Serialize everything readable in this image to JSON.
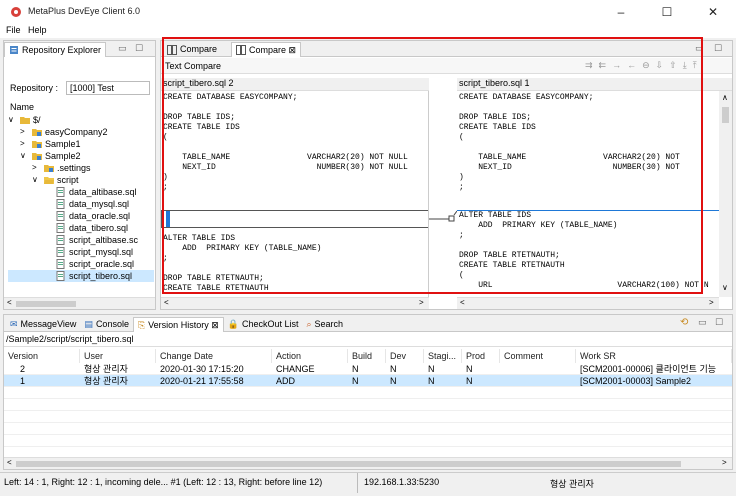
{
  "window": {
    "title": "MetaPlus DevEye Client 6.0",
    "minimize": "–",
    "maximize": "☐",
    "close": "✕"
  },
  "menu": [
    "File",
    "Help"
  ],
  "repo_explorer": {
    "tab_label": "Repository Explorer",
    "repo_label": "Repository :",
    "repo_value": "[1000] Test",
    "name_header": "Name",
    "tree": [
      {
        "label": "$/",
        "level": 0,
        "expand": "∨",
        "type": "folder"
      },
      {
        "label": "easyCompany2",
        "level": 1,
        "expand": ">",
        "type": "project"
      },
      {
        "label": "Sample1",
        "level": 1,
        "expand": ">",
        "type": "project"
      },
      {
        "label": "Sample2",
        "level": 1,
        "expand": "∨",
        "type": "project"
      },
      {
        "label": ".settings",
        "level": 2,
        "expand": ">",
        "type": "project"
      },
      {
        "label": "script",
        "level": 2,
        "expand": "∨",
        "type": "folderopen"
      },
      {
        "label": "data_altibase.sql",
        "level": 3,
        "expand": "",
        "type": "file"
      },
      {
        "label": "data_mysql.sql",
        "level": 3,
        "expand": "",
        "type": "file"
      },
      {
        "label": "data_oracle.sql",
        "level": 3,
        "expand": "",
        "type": "file"
      },
      {
        "label": "data_tibero.sql",
        "level": 3,
        "expand": "",
        "type": "file"
      },
      {
        "label": "script_altibase.sc",
        "level": 3,
        "expand": "",
        "type": "file"
      },
      {
        "label": "script_mysql.sql",
        "level": 3,
        "expand": "",
        "type": "file"
      },
      {
        "label": "script_oracle.sql",
        "level": 3,
        "expand": "",
        "type": "file"
      },
      {
        "label": "script_tibero.sql",
        "level": 3,
        "expand": "",
        "type": "file",
        "selected": true
      }
    ]
  },
  "editor": {
    "tabs": [
      {
        "label": "Compare",
        "active": false
      },
      {
        "label": "Compare ⊠",
        "active": true
      }
    ],
    "section_label": "Text Compare",
    "left_file": "script_tibero.sql 2",
    "right_file": "script_tibero.sql 1",
    "left_top": "CREATE DATABASE EASYCOMPANY;\n\nDROP TABLE IDS;\nCREATE TABLE IDS\n(\n\n    TABLE_NAME                VARCHAR2(20) NOT NULL\n    NEXT_ID                     NUMBER(30) NOT NULL\n)\n;",
    "left_bottom": "ALTER TABLE IDS\n    ADD  PRIMARY KEY (TABLE_NAME)\n;\n\nDROP TABLE RTETNAUTH;\nCREATE TABLE RTETNAUTH",
    "right_top": "CREATE DATABASE EASYCOMPANY;\n\nDROP TABLE IDS;\nCREATE TABLE IDS\n(\n\n    TABLE_NAME                VARCHAR2(20) NOT\n    NEXT_ID                     NUMBER(30) NOT\n)\n;",
    "right_added": "ALTER TABLE IDS\n    ADD  PRIMARY KEY (TABLE_NAME)\n;",
    "right_bottom": "DROP TABLE RTETNAUTH;\nCREATE TABLE RTETNAUTH\n(\n    URL                          VARCHAR2(100) NOT N"
  },
  "bottom": {
    "tabs": [
      {
        "label": "MessageView",
        "icon": "message-icon"
      },
      {
        "label": "Console",
        "icon": "console-icon"
      },
      {
        "label": "Version History ⊠",
        "icon": "history-icon"
      },
      {
        "label": "CheckOut List",
        "icon": "lock-icon"
      },
      {
        "label": "Search",
        "icon": "search-icon"
      }
    ],
    "path": "/Sample2/script/script_tibero.sql",
    "columns": [
      "Version",
      "User",
      "Change Date",
      "Action",
      "Build",
      "Dev",
      "Stagi...",
      "Prod",
      "Comment",
      "Work SR"
    ],
    "rows": [
      [
        "2",
        "형상 관리자",
        "2020-01-30 17:15:20",
        "CHANGE",
        "N",
        "N",
        "N",
        "N",
        "",
        "[SCM2001-00006] 클라이언트 기능"
      ],
      [
        "1",
        "형상 관리자",
        "2020-01-21 17:55:58",
        "ADD",
        "N",
        "N",
        "N",
        "N",
        "",
        "[SCM2001-00003] Sample2"
      ]
    ]
  },
  "status": {
    "message": "Left: 14 : 1, Right: 12 : 1, incoming dele... #1 (Left: 12 : 13, Right: before line 12)",
    "ip": "192.168.1.33:5230",
    "user": "형상 관리자"
  },
  "colors": {
    "highlight_border": "#e01010",
    "selected_row": "#cce8ff",
    "diff_blue": "#1e78d7"
  }
}
